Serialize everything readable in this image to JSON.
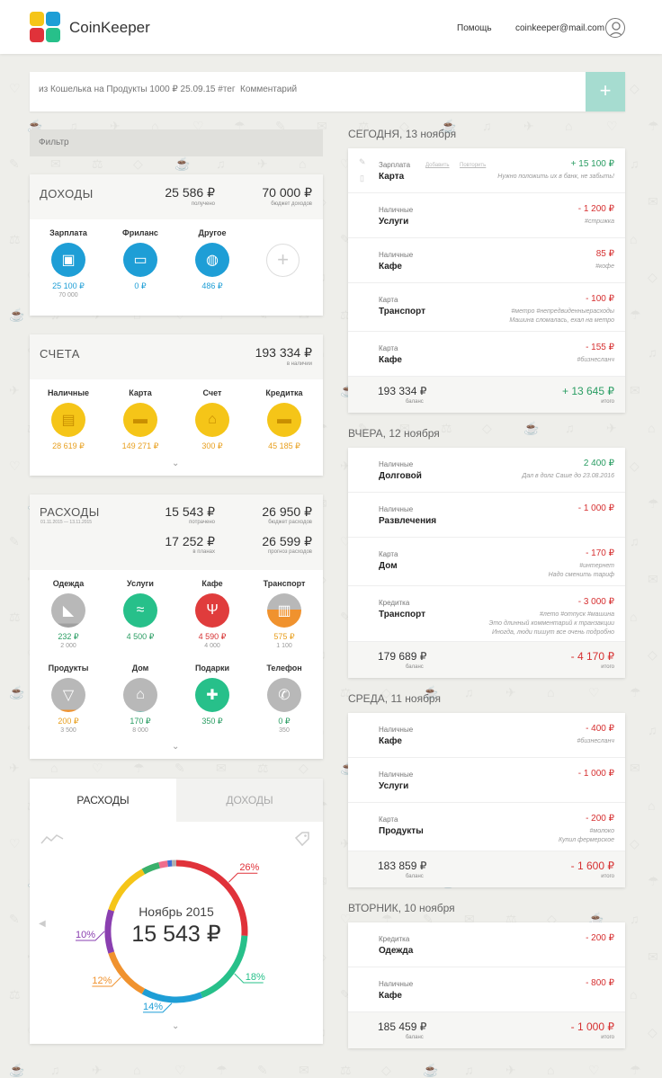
{
  "header": {
    "brand": "CoinKeeper",
    "help": "Помощь",
    "email": "coinkeeper@mail.com"
  },
  "entry": {
    "placeholder": "из Кошелька на Продукты 1000 ₽ 25.09.15 #тег  Комментарий",
    "add": "+"
  },
  "filter": {
    "label": "Фильтр"
  },
  "income": {
    "title": "ДОХОДЫ",
    "received": "25 586 ₽",
    "received_label": "получено",
    "budget": "70 000 ₽",
    "budget_label": "бюджет доходов",
    "items": [
      {
        "name": "Зарплата",
        "value": "25 100 ₽",
        "plan": "70 000",
        "icon": "wallet-icon"
      },
      {
        "name": "Фриланс",
        "value": "0 ₽",
        "plan": "",
        "icon": "monitor-icon"
      },
      {
        "name": "Другое",
        "value": "486 ₽",
        "plan": "",
        "icon": "globe-icon"
      }
    ],
    "add": "+"
  },
  "accounts": {
    "title": "СЧЕТА",
    "total": "193 334 ₽",
    "total_label": "в наличии",
    "items": [
      {
        "name": "Наличные",
        "value": "28 619 ₽",
        "icon": "cash-icon"
      },
      {
        "name": "Карта",
        "value": "149 271 ₽",
        "icon": "card-icon"
      },
      {
        "name": "Счет",
        "value": "300 ₽",
        "icon": "bank-icon"
      },
      {
        "name": "Кредитка",
        "value": "45 185 ₽",
        "icon": "credit-card-icon"
      }
    ]
  },
  "expenses": {
    "title": "РАСХОДЫ",
    "period": "01.11.2015 — 13.11.2015",
    "spent": "15 543 ₽",
    "spent_label": "потрачено",
    "budget": "26 950 ₽",
    "budget_label": "бюджет расходов",
    "planned": "17 252 ₽",
    "planned_label": "в планах",
    "forecast": "26 599 ₽",
    "forecast_label": "прогноз расходов",
    "items": [
      {
        "name": "Одежда",
        "value": "232 ₽",
        "plan": "2 000",
        "color": "#a0a0a0",
        "fill": 0.12,
        "vcolor": "#2a9d63",
        "icon": "sock-icon"
      },
      {
        "name": "Услуги",
        "value": "4 500 ₽",
        "plan": "",
        "color": "#27c08a",
        "fill": 1,
        "vcolor": "#2a9d63",
        "icon": "mustache-icon"
      },
      {
        "name": "Кафе",
        "value": "4 590 ₽",
        "plan": "4 000",
        "color": "#e03c3c",
        "fill": 1,
        "vcolor": "#d63031",
        "icon": "cutlery-icon"
      },
      {
        "name": "Транспорт",
        "value": "575 ₽",
        "plan": "1 100",
        "color": "#f0922e",
        "fill": 0.52,
        "vcolor": "#e8a020",
        "icon": "bus-icon"
      },
      {
        "name": "Продукты",
        "value": "200 ₽",
        "plan": "3 500",
        "color": "#f0922e",
        "fill": 0.06,
        "vcolor": "#e8a020",
        "icon": "basket-icon"
      },
      {
        "name": "Дом",
        "value": "170 ₽",
        "plan": "8 000",
        "color": "#7ab8b0",
        "fill": 0.02,
        "vcolor": "#2a9d63",
        "icon": "house-icon"
      },
      {
        "name": "Подарки",
        "value": "350 ₽",
        "plan": "",
        "color": "#27c08a",
        "fill": 1,
        "vcolor": "#2a9d63",
        "icon": "gift-icon"
      },
      {
        "name": "Телефон",
        "value": "0 ₽",
        "plan": "350",
        "color": "#a0a0a0",
        "fill": 0,
        "vcolor": "#2a9d63",
        "icon": "phone-icon"
      }
    ]
  },
  "chart_tabs": {
    "expenses": "РАСХОДЫ",
    "income": "ДОХОДЫ"
  },
  "chart_data": {
    "type": "pie",
    "center_title": "Ноябрь 2015",
    "center_value": "15 543 ₽",
    "slices": [
      {
        "label": "26%",
        "value": 26,
        "color": "#e0323a"
      },
      {
        "label": "18%",
        "value": 18,
        "color": "#27c08a"
      },
      {
        "label": "14%",
        "value": 14,
        "color": "#1e9ed6"
      },
      {
        "label": "12%",
        "value": 12,
        "color": "#f0922e"
      },
      {
        "label": "10%",
        "value": 10,
        "color": "#8a3fb0"
      }
    ],
    "other": [
      {
        "value": 12,
        "color": "#f5c518"
      },
      {
        "value": 4,
        "color": "#3ab06b"
      },
      {
        "value": 2,
        "color": "#f06d8c"
      },
      {
        "value": 1,
        "color": "#4070d6"
      },
      {
        "value": 1,
        "color": "#b0b0b0"
      }
    ]
  },
  "days": [
    {
      "title": "СЕГОДНЯ, 13 ноября",
      "rows": [
        {
          "account": "Зарплата",
          "category": "Карта",
          "amount": "+ 15 100 ₽",
          "sign": "pos",
          "comment": "Нужно положить их в банк, не забыть!",
          "actions": [
            "Добавить",
            "Повторить"
          ]
        },
        {
          "account": "Наличные",
          "category": "Услуги",
          "amount": "- 1 200 ₽",
          "sign": "neg",
          "comment": "#стрижка"
        },
        {
          "account": "Наличные",
          "category": "Кафе",
          "amount": "85 ₽",
          "sign": "neg",
          "comment": "#кофе"
        },
        {
          "account": "Карта",
          "category": "Транспорт",
          "amount": "- 100 ₽",
          "sign": "neg",
          "comment": "#метро #непредвиденныерасходы\nМашина сломалась, ехал на метро"
        },
        {
          "account": "Карта",
          "category": "Кафе",
          "amount": "- 155 ₽",
          "sign": "neg",
          "comment": "#бизнесланч"
        }
      ],
      "balance": "193 334 ₽",
      "balance_label": "баланс",
      "total": "+ 13 645 ₽",
      "total_sign": "pos",
      "total_label": "итого"
    },
    {
      "title": "ВЧЕРА, 12 ноября",
      "rows": [
        {
          "account": "Наличные",
          "category": "Долговой",
          "amount": "2 400 ₽",
          "sign": "pos",
          "comment": "Дал в долг Саше до 23.08.2016"
        },
        {
          "account": "Наличные",
          "category": "Развлечения",
          "amount": "- 1 000 ₽",
          "sign": "neg",
          "comment": ""
        },
        {
          "account": "Карта",
          "category": "Дом",
          "amount": "- 170 ₽",
          "sign": "neg",
          "comment": "#интернет\nНадо сменить тариф"
        },
        {
          "account": "Кредитка",
          "category": "Транспорт",
          "amount": "- 3 000 ₽",
          "sign": "neg",
          "comment": "#лето #отпуск #машина\nЭто длинный комментарий к транзакции\nИногда, люди пишут все очень подробно"
        }
      ],
      "balance": "179 689 ₽",
      "balance_label": "баланс",
      "total": "- 4 170 ₽",
      "total_sign": "neg",
      "total_label": "итого"
    },
    {
      "title": "СРЕДА, 11 ноября",
      "rows": [
        {
          "account": "Наличные",
          "category": "Кафе",
          "amount": "- 400 ₽",
          "sign": "neg",
          "comment": "#бизнесланч"
        },
        {
          "account": "Наличные",
          "category": "Услуги",
          "amount": "- 1 000 ₽",
          "sign": "neg",
          "comment": ""
        },
        {
          "account": "Карта",
          "category": "Продукты",
          "amount": "- 200 ₽",
          "sign": "neg",
          "comment": "#молоко\nКупил фермерское"
        }
      ],
      "balance": "183 859 ₽",
      "balance_label": "баланс",
      "total": "- 1 600 ₽",
      "total_sign": "neg",
      "total_label": "итого"
    },
    {
      "title": "ВТОРНИК, 10 ноября",
      "rows": [
        {
          "account": "Кредитка",
          "category": "Одежда",
          "amount": "- 200 ₽",
          "sign": "neg",
          "comment": ""
        },
        {
          "account": "Наличные",
          "category": "Кафе",
          "amount": "- 800 ₽",
          "sign": "neg",
          "comment": ""
        }
      ],
      "balance": "185 459 ₽",
      "balance_label": "баланс",
      "total": "- 1 000 ₽",
      "total_sign": "neg",
      "total_label": "итого"
    }
  ]
}
